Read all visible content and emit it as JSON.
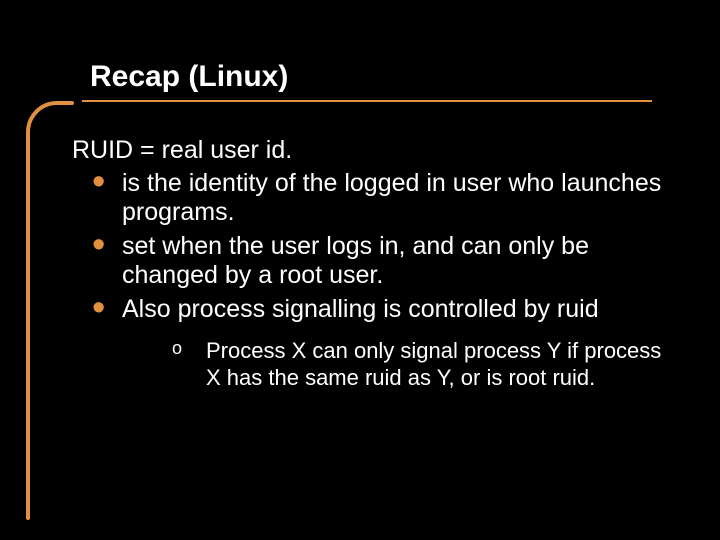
{
  "title": "Recap (Linux)",
  "lead": "RUID = real user id.",
  "bullets": [
    "is the identity of the logged in user who launches programs.",
    "set when the user logs in, and can only be changed by a root user.",
    "Also process signalling is controlled by ruid"
  ],
  "subbullets": [
    "Process X can only signal process Y if process X has the same ruid as Y, or is root ruid."
  ],
  "accent_color": "#e28f3f"
}
